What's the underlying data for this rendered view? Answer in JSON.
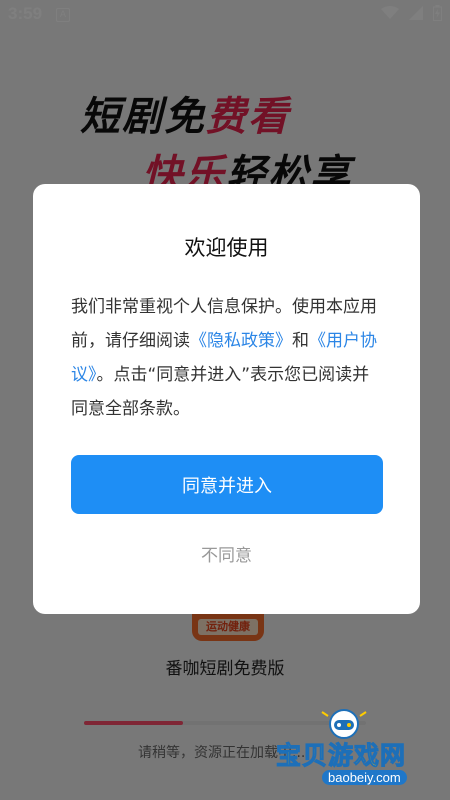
{
  "status_bar": {
    "time": "3:59",
    "app_icon_glyph": "A",
    "icons": [
      "wifi-icon",
      "signal-icon",
      "battery-charging-icon"
    ]
  },
  "splash": {
    "title_line1_prefix": "短剧免",
    "title_line1_highlight": "费看",
    "title_line2_highlight": "快乐",
    "title_line2_suffix": "轻松享",
    "logo_caption": "运动健康",
    "app_name": "番咖短剧免费版",
    "loading_text": "请稍等，资源正在加载中...",
    "loading_progress": 0.35
  },
  "dialog": {
    "title": "欢迎使用",
    "body_part1": "我们非常重视个人信息保护。使用本应用前，请仔细阅读",
    "privacy_link": "《隐私政策》",
    "body_part2": "和",
    "terms_link": "《用户协议》",
    "body_part3": "。点击“同意并进入”表示您已阅读并同意全部条款。",
    "agree_label": "同意并进入",
    "disagree_label": "不同意"
  },
  "watermark": {
    "text": "宝贝游戏网",
    "url": "baobeiy.com"
  },
  "colors": {
    "accent_blue": "#1e8ef5",
    "link_blue": "#2c86e6",
    "highlight_red": "#e5224d",
    "overlay": "rgba(0,0,0,0.5)"
  }
}
